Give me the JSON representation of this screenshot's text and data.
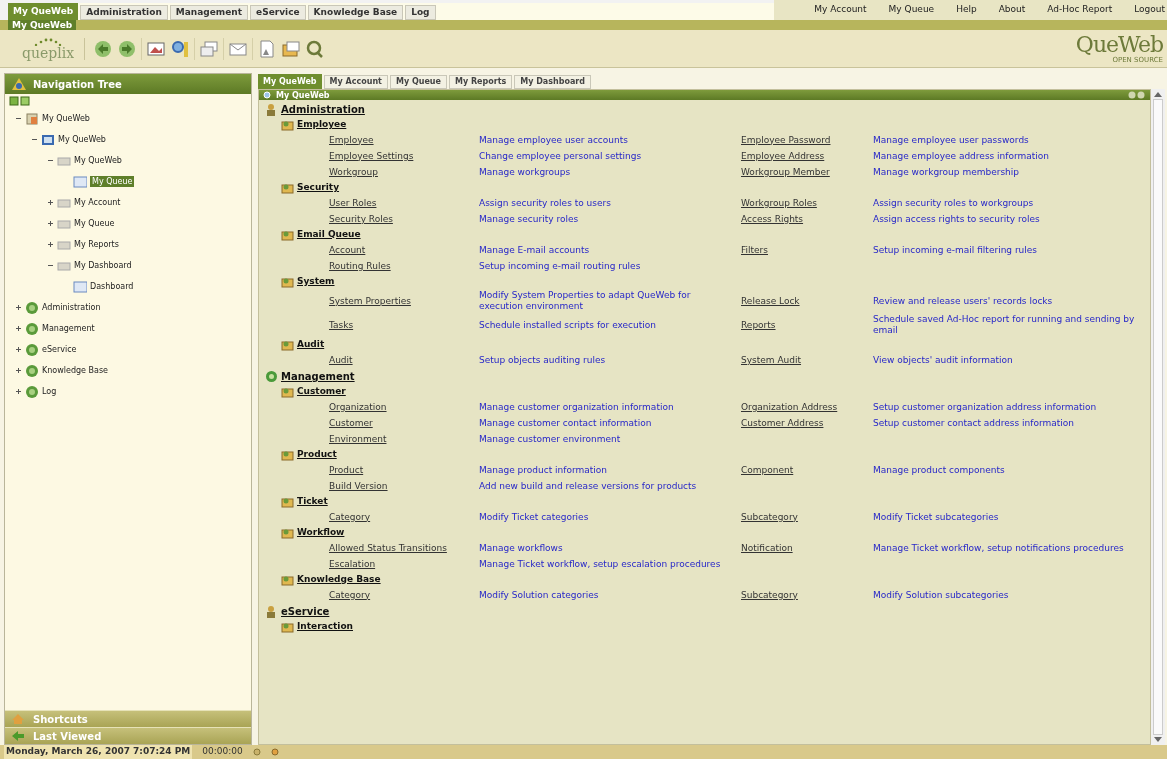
{
  "top_tabs": [
    {
      "label": "My QueWeb",
      "selected": true
    },
    {
      "label": "Administration",
      "selected": false
    },
    {
      "label": "Management",
      "selected": false
    },
    {
      "label": "eService",
      "selected": false
    },
    {
      "label": "Knowledge Base",
      "selected": false
    },
    {
      "label": "Log",
      "selected": false
    }
  ],
  "top_links": [
    "My Account",
    "My Queue",
    "Help",
    "About",
    "Ad-Hoc Report",
    "Logout"
  ],
  "band_label": "My QueWeb",
  "toolbar": {
    "logo": "queplix",
    "brand": "QueWeb",
    "brand_sub": "OPEN SOURCE"
  },
  "navigation": {
    "title": "Navigation Tree",
    "tree": [
      {
        "label": "My QueWeb",
        "expanded": true,
        "selected": false,
        "children": [
          {
            "label": "My QueWeb",
            "expanded": true,
            "selected": false,
            "children": [
              {
                "label": "My QueWeb",
                "expanded": true,
                "selected": false,
                "children": [
                  {
                    "label": "My Queue",
                    "selected": true
                  }
                ]
              },
              {
                "label": "My Account",
                "expanded": false,
                "selected": false
              },
              {
                "label": "My Queue",
                "expanded": false,
                "selected": false
              },
              {
                "label": "My Reports",
                "expanded": false,
                "selected": false
              },
              {
                "label": "My Dashboard",
                "expanded": true,
                "selected": false,
                "children": [
                  {
                    "label": "Dashboard",
                    "selected": false
                  }
                ]
              }
            ]
          }
        ]
      },
      {
        "label": "Administration",
        "expanded": false,
        "selected": false
      },
      {
        "label": "Management",
        "expanded": false,
        "selected": false
      },
      {
        "label": "eService",
        "expanded": false,
        "selected": false
      },
      {
        "label": "Knowledge Base",
        "expanded": false,
        "selected": false
      },
      {
        "label": "Log",
        "expanded": false,
        "selected": false
      }
    ],
    "panels": [
      "Shortcuts",
      "Last Viewed"
    ]
  },
  "content_tabs": [
    {
      "label": "My QueWeb",
      "selected": true
    },
    {
      "label": "My Account",
      "selected": false
    },
    {
      "label": "My Queue",
      "selected": false
    },
    {
      "label": "My Reports",
      "selected": false
    },
    {
      "label": "My Dashboard",
      "selected": false
    }
  ],
  "panel_title": "My QueWeb",
  "sections": [
    {
      "title": "Administration",
      "groups": [
        {
          "title": "Employee",
          "rows": [
            {
              "name": "Employee",
              "description": "Manage employee user accounts",
              "name_2": "Employee Password",
              "description_2": "Manage employee user passwords"
            },
            {
              "name": "Employee Settings",
              "description": "Change employee personal settings",
              "name_2": "Employee Address",
              "description_2": "Manage employee address information"
            },
            {
              "name": "Workgroup",
              "description": "Manage workgroups",
              "name_2": "Workgroup Member",
              "description_2": "Manage workgroup membership"
            }
          ]
        },
        {
          "title": "Security",
          "rows": [
            {
              "name": "User Roles",
              "description": "Assign security roles to users",
              "name_2": "Workgroup Roles",
              "description_2": "Assign security roles to workgroups"
            },
            {
              "name": "Security Roles",
              "description": "Manage security roles",
              "name_2": "Access Rights",
              "description_2": "Assign access rights to security roles"
            }
          ]
        },
        {
          "title": "Email Queue",
          "rows": [
            {
              "name": "Account",
              "description": "Manage E-mail accounts",
              "name_2": "Filters",
              "description_2": "Setup incoming e-mail filtering rules"
            },
            {
              "name": "Routing Rules",
              "description": "Setup incoming e-mail routing rules"
            }
          ]
        },
        {
          "title": "System",
          "rows": [
            {
              "name": "System Properties",
              "description": "Modify System Properties to adapt QueWeb for execution environment",
              "name_2": "Release Lock",
              "description_2": "Review and release users' records locks"
            },
            {
              "name": "Tasks",
              "description": "Schedule installed scripts for execution",
              "name_2": "Reports",
              "description_2": "Schedule saved Ad-Hoc report for running and sending by email"
            }
          ]
        },
        {
          "title": "Audit",
          "rows": [
            {
              "name": "Audit",
              "description": "Setup objects auditing rules",
              "name_2": "System Audit",
              "description_2": "View objects' audit information"
            }
          ]
        }
      ]
    },
    {
      "title": "Management",
      "groups": [
        {
          "title": "Customer",
          "rows": [
            {
              "name": "Organization",
              "description": "Manage customer organization information",
              "name_2": "Organization Address",
              "description_2": "Setup customer organization address information"
            },
            {
              "name": "Customer",
              "description": "Manage customer contact information",
              "name_2": "Customer Address",
              "description_2": "Setup customer contact address information"
            },
            {
              "name": "Environment",
              "description": "Manage customer environment"
            }
          ]
        },
        {
          "title": "Product",
          "rows": [
            {
              "name": "Product",
              "description": "Manage product information",
              "name_2": "Component",
              "description_2": "Manage product components"
            },
            {
              "name": "Build Version",
              "description": "Add new build and release versions for products"
            }
          ]
        },
        {
          "title": "Ticket",
          "rows": [
            {
              "name": "Category",
              "description": "Modify Ticket categories",
              "name_2": "Subcategory",
              "description_2": "Modify Ticket subcategories"
            }
          ]
        },
        {
          "title": "Workflow",
          "rows": [
            {
              "name": "Allowed Status Transitions",
              "description": "Manage workflows",
              "name_2": "Notification",
              "description_2": "Manage Ticket workflow, setup notifications procedures"
            },
            {
              "name": "Escalation",
              "description": "Manage Ticket workflow, setup escalation procedures"
            }
          ]
        },
        {
          "title": "Knowledge Base",
          "rows": [
            {
              "name": "Category",
              "description": "Modify Solution categories",
              "name_2": "Subcategory",
              "description_2": "Modify Solution subcategories"
            }
          ]
        }
      ]
    },
    {
      "title": "eService",
      "groups": [
        {
          "title": "Interaction"
        }
      ]
    }
  ],
  "status_bar": {
    "date": "Monday, March 26, 2007 7:07:24 PM",
    "timer": "00:00:00"
  }
}
